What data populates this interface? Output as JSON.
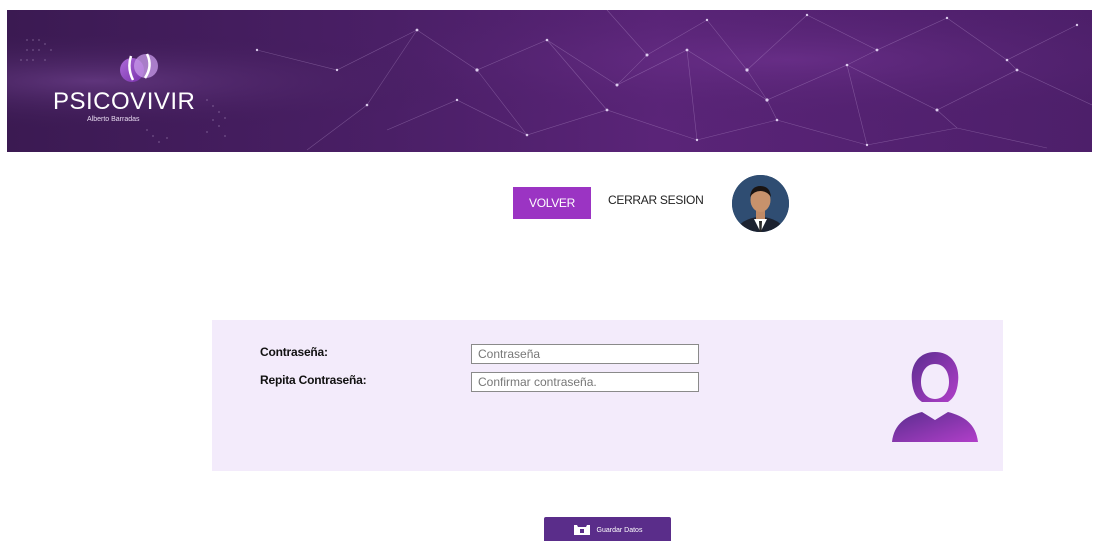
{
  "header": {
    "brand_name": "PSICOVIVIR",
    "brand_subtitle": "Alberto Barradas"
  },
  "nav": {
    "back_label": "VOLVER",
    "logout_label": "CERRAR SESION"
  },
  "form": {
    "password_label": "Contraseña:",
    "password_placeholder": "Contraseña",
    "password_value": "",
    "confirm_label": "Repita Contraseña:",
    "confirm_placeholder": "Confirmar contraseña.",
    "confirm_value": ""
  },
  "actions": {
    "save_label": "Guardar Datos"
  },
  "colors": {
    "banner_purple": "#4a1f66",
    "accent_purple": "#9b34c3",
    "panel_bg": "#f3ebfb",
    "save_button": "#5a2d8a"
  },
  "icons": {
    "user_avatar": "user-silhouette-icon",
    "save": "save-icon"
  }
}
